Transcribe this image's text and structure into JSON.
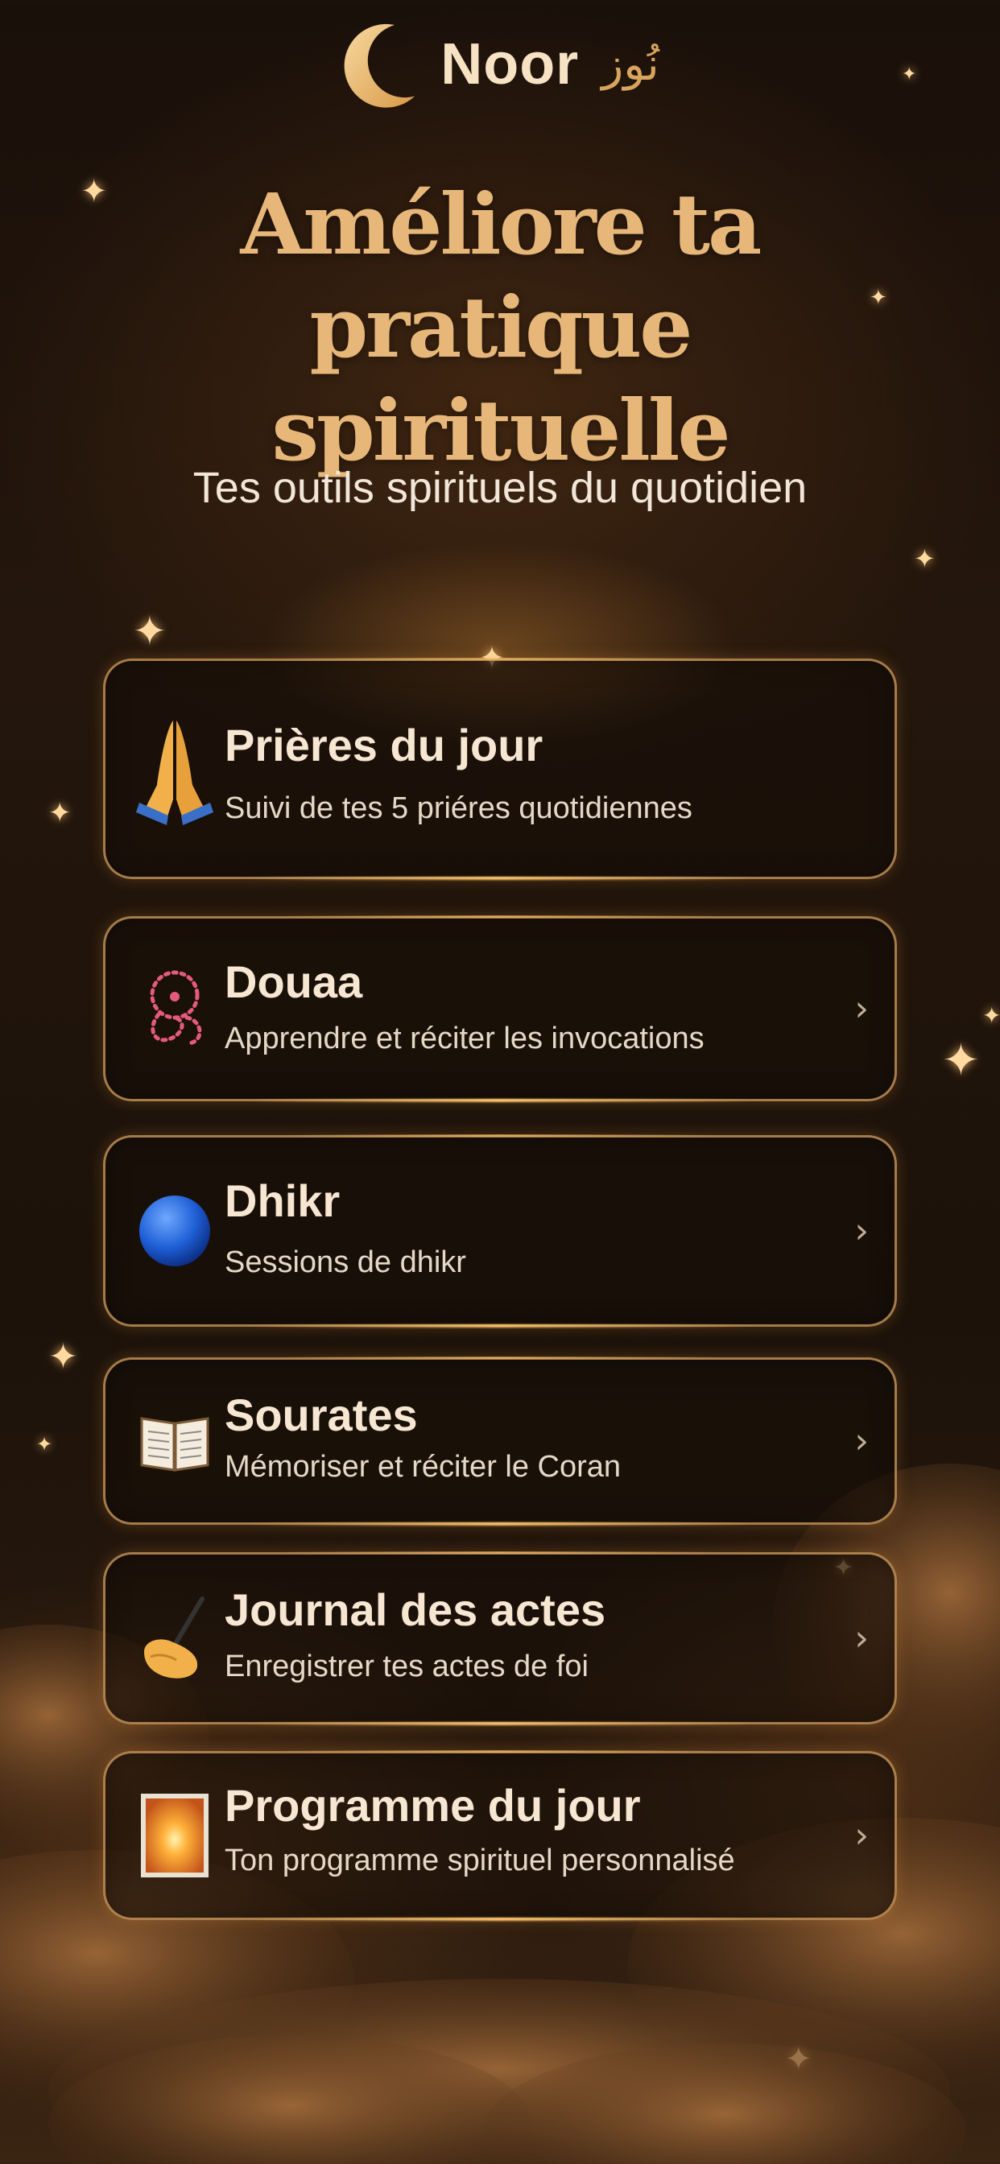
{
  "brand": {
    "name": "Noor",
    "arabic": "نُوز"
  },
  "headline": {
    "line1": "Améliore ta",
    "line2": "pratique spirituelle"
  },
  "subtitle": "Tes outils spirituels du quotidien",
  "cards": [
    {
      "title": "Prières du jour",
      "desc": "Suivi de tes 5 priéres quotidiennes",
      "icon": "praying-hands-icon",
      "chevron": ""
    },
    {
      "title": "Douaa",
      "desc": "Apprendre et réciter les invocations",
      "icon": "prayer-beads-icon",
      "chevron": "›"
    },
    {
      "title": "Dhikr",
      "desc": "Sessions de dhikr",
      "icon": "blue-circle-icon",
      "chevron": "›"
    },
    {
      "title": "Sourates",
      "desc": "Mémoriser et réciter le Coran",
      "icon": "open-book-icon",
      "chevron": "›"
    },
    {
      "title": "Journal des actes",
      "desc": "Enregistrer tes actes de foi",
      "icon": "writing-hand-icon",
      "chevron": "›"
    },
    {
      "title": "Programme du jour",
      "desc": "Ton programme spirituel personnalisé",
      "icon": "sunrise-icon",
      "chevron": "›"
    }
  ],
  "colors": {
    "accent_gold": "#e7b77a",
    "card_border": "#d6a060",
    "background_dark": "#1a100a"
  }
}
